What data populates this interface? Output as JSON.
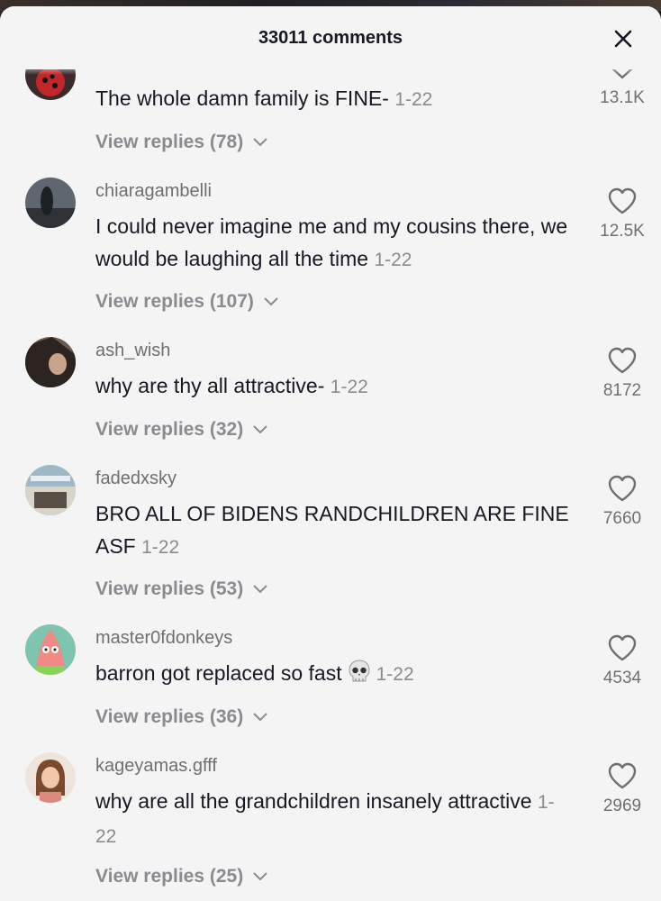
{
  "header": {
    "title": "33011 comments",
    "close_icon": "close-icon"
  },
  "comments": [
    {
      "text": "The whole damn family is FINE-",
      "date": "1-22",
      "likes": "13.1K",
      "replies": "View replies (78)"
    },
    {
      "username": "chiaragambelli",
      "text": "I could never imagine me and my cousins there, we would be laughing all the time",
      "date": "1-22",
      "likes": "12.5K",
      "replies": "View replies (107)"
    },
    {
      "username": "ash_wish",
      "text": "why are thy all attractive-",
      "date": "1-22",
      "likes": "8172",
      "replies": "View replies (32)"
    },
    {
      "username": "fadedxsky",
      "text": "BRO ALL OF BIDENS RANDCHILDREN ARE FINE ASF",
      "date": "1-22",
      "likes": "7660",
      "replies": "View replies (53)"
    },
    {
      "username": "master0fdonkeys",
      "text": "barron got replaced so fast",
      "emoji": "skull-emoji",
      "date": "1-22",
      "likes": "4534",
      "replies": "View replies (36)"
    },
    {
      "username": "kageyamas.gfff",
      "text": "why are all the grandchildren insanely attractive",
      "date": "1-22",
      "likes": "2969",
      "replies": "View replies (25)"
    }
  ],
  "colors": {
    "sheet": "#f4f4f4",
    "text": "#161823",
    "muted": "#8a8b91"
  }
}
